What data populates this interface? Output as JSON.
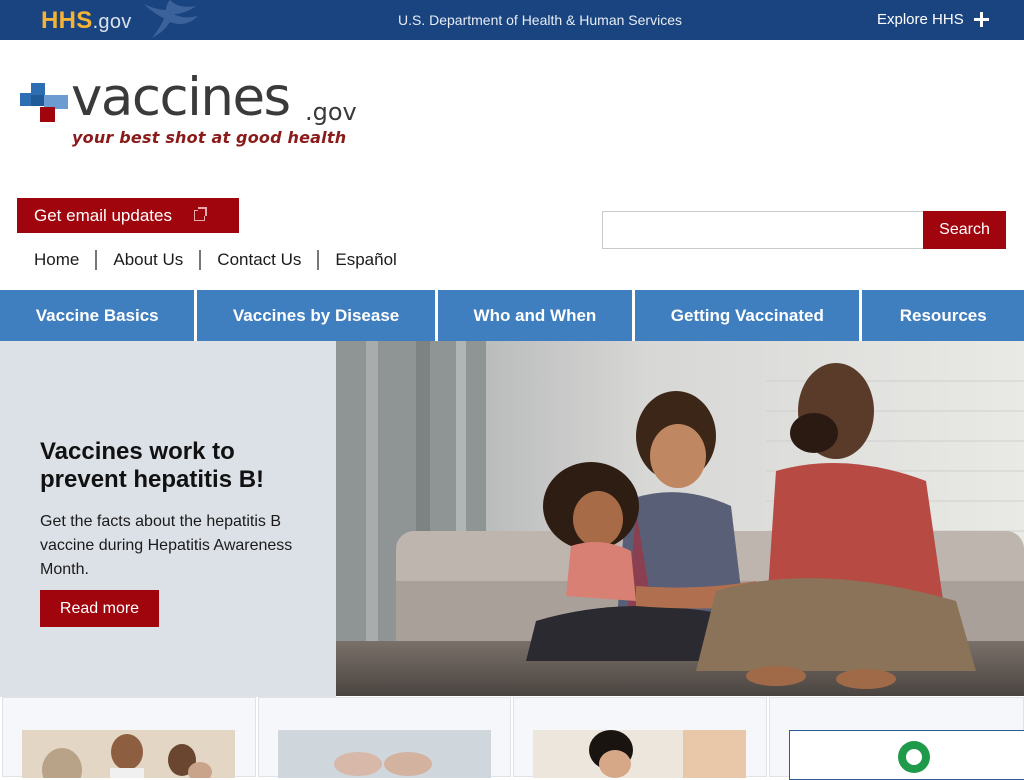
{
  "hhs_bar": {
    "logo_main": "HHS",
    "logo_suffix": ".gov",
    "department": "U.S. Department of Health & Human Services",
    "explore_label": "Explore HHS"
  },
  "site": {
    "logo_word": "vaccines",
    "logo_suffix": ".gov",
    "tagline": "your best shot at good health"
  },
  "email_updates": {
    "label": "Get email updates"
  },
  "utility_nav": {
    "home": "Home",
    "about": "About Us",
    "contact": "Contact Us",
    "espanol": "Español"
  },
  "search": {
    "value": "",
    "button_label": "Search"
  },
  "main_nav": {
    "items": [
      {
        "label": "Vaccine Basics"
      },
      {
        "label": "Vaccines by Disease"
      },
      {
        "label": "Who and When"
      },
      {
        "label": "Getting Vaccinated"
      },
      {
        "label": "Resources"
      }
    ]
  },
  "hero": {
    "title": "Vaccines work to prevent hepatitis B!",
    "body": "Get the facts about the hepatitis B vaccine during Hepatitis Awareness Month.",
    "button_label": "Read more"
  },
  "colors": {
    "hhs_blue": "#1a4480",
    "nav_blue": "#3f7fc0",
    "brand_red": "#a0050d",
    "hero_panel": "#dce1e8"
  }
}
